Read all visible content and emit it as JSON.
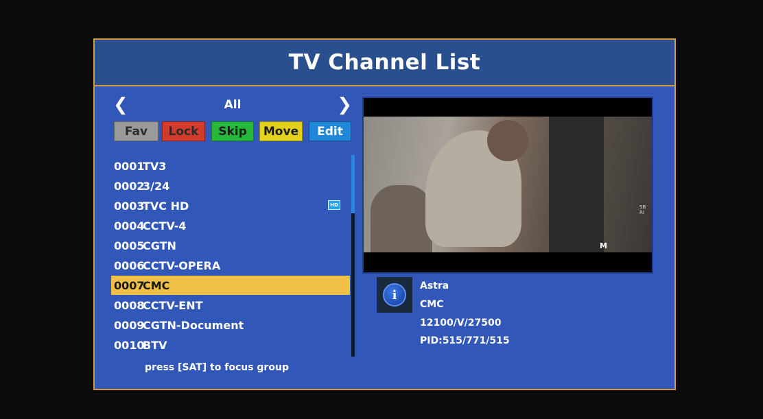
{
  "header": {
    "title": "TV Channel List"
  },
  "group": {
    "left_arrow": "❮",
    "name": "All",
    "right_arrow": "❯"
  },
  "buttons": [
    {
      "label": "Fav",
      "bg": "#9a9a9a",
      "fg": "#2b2b2b"
    },
    {
      "label": "Lock",
      "bg": "#d23a2a",
      "fg": "#2b2b2b"
    },
    {
      "label": "Skip",
      "bg": "#25b83a",
      "fg": "#1c1c1c"
    },
    {
      "label": "Move",
      "bg": "#e3d11c",
      "fg": "#1c1c1c"
    },
    {
      "label": "Edit",
      "bg": "#1f86d8",
      "fg": "#ffffff"
    }
  ],
  "channels": [
    {
      "number": "0001",
      "name": "TV3",
      "hd": false,
      "selected": false
    },
    {
      "number": "0002",
      "name": "3/24",
      "hd": false,
      "selected": false
    },
    {
      "number": "0003",
      "name": "TVC HD",
      "hd": true,
      "selected": false
    },
    {
      "number": "0004",
      "name": "CCTV-4",
      "hd": false,
      "selected": false
    },
    {
      "number": "0005",
      "name": "CGTN",
      "hd": false,
      "selected": false
    },
    {
      "number": "0006",
      "name": "CCTV-OPERA",
      "hd": false,
      "selected": false
    },
    {
      "number": "0007",
      "name": "CMC",
      "hd": false,
      "selected": true
    },
    {
      "number": "0008",
      "name": "CCTV-ENT",
      "hd": false,
      "selected": false
    },
    {
      "number": "0009",
      "name": "CGTN-Document",
      "hd": false,
      "selected": false
    },
    {
      "number": "0010",
      "name": "BTV",
      "hd": false,
      "selected": false
    }
  ],
  "hd_badge": "HD",
  "scrollbar": {
    "position": 0.0,
    "visible_fraction": 0.29
  },
  "hint": "press [SAT] to focus group",
  "info": {
    "icon": "info-icon",
    "icon_glyph": "i",
    "satellite": "Astra",
    "channel": "CMC",
    "transponder": "12100/V/27500",
    "pid": "PID:515/771/515"
  },
  "preview": {
    "broadcaster_logo": "M",
    "side_mark": "SB\nRI"
  },
  "colors": {
    "panel": "#3158b8",
    "title_bar": "#2a4f8e",
    "border": "#d89a3a",
    "selection": "#efc045"
  }
}
